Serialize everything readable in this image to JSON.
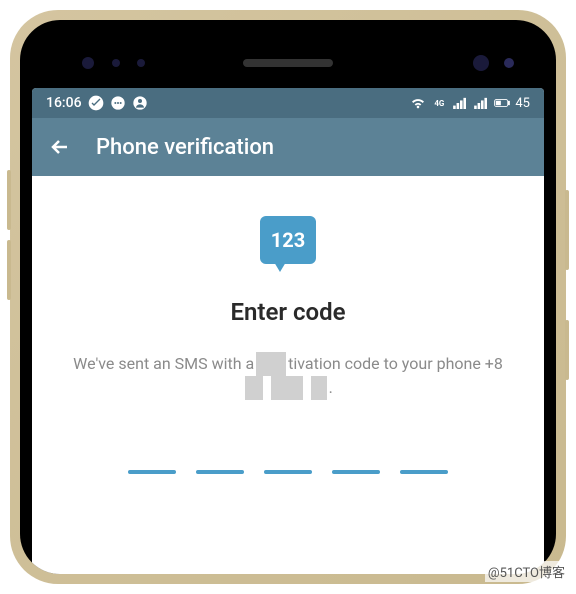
{
  "status_bar": {
    "time": "16:06",
    "battery": "45"
  },
  "app_bar": {
    "title": "Phone verification"
  },
  "content": {
    "icon_text": "123",
    "heading": "Enter code",
    "description_prefix": "We've sent an SMS with a",
    "description_mid": "tivation code to your phone +8",
    "description_suffix": "."
  },
  "watermark": "@51CTO博客"
}
